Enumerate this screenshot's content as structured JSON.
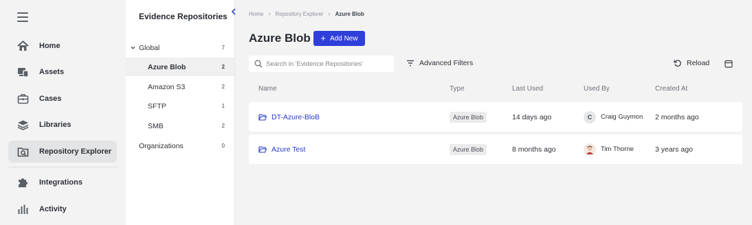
{
  "nav": {
    "items": [
      {
        "label": "Home",
        "icon": "home-icon"
      },
      {
        "label": "Assets",
        "icon": "assets-icon"
      },
      {
        "label": "Cases",
        "icon": "briefcase-icon"
      },
      {
        "label": "Libraries",
        "icon": "layers-icon"
      },
      {
        "label": "Repository Explorer",
        "icon": "folder-search-icon"
      },
      {
        "label": "Integrations",
        "icon": "puzzle-icon"
      },
      {
        "label": "Activity",
        "icon": "bar-chart-icon"
      }
    ],
    "active": "Repository Explorer"
  },
  "tree": {
    "title": "Evidence Repositories",
    "global": {
      "label": "Global",
      "count": "7"
    },
    "children": [
      {
        "label": "Azure Blob",
        "count": "2"
      },
      {
        "label": "Amazon S3",
        "count": "2"
      },
      {
        "label": "SFTP",
        "count": "1"
      },
      {
        "label": "SMB",
        "count": "2"
      }
    ],
    "organizations": {
      "label": "Organizations",
      "count": "0"
    }
  },
  "breadcrumb": {
    "home": "Home",
    "section": "Repository Explorer",
    "current": "Azure Blob"
  },
  "header": {
    "title": "Azure Blob",
    "add_label": "Add New"
  },
  "toolbar": {
    "search_placeholder": "Search in 'Evidence Repositories'",
    "advanced_filters": "Advanced Filters",
    "reload": "Reload"
  },
  "table": {
    "columns": [
      "Name",
      "Type",
      "Last Used",
      "Used By",
      "Created At"
    ],
    "rows": [
      {
        "name": "DT-Azure-BloB",
        "type": "Azure Blob",
        "last_used": "14 days ago",
        "used_by": "Craig Guymon",
        "avatar_initial": "C",
        "created_at": "2 months ago"
      },
      {
        "name": "Azure Test",
        "type": "Azure Blob",
        "last_used": "8 months ago",
        "used_by": "Tim Thorne",
        "avatar_initial": "",
        "created_at": "3 years ago"
      }
    ]
  },
  "colors": {
    "accent": "#2f3fd9",
    "link": "#2638c4",
    "sidebar_bg": "#f3f3f4",
    "active_item": "#e3e4e6"
  }
}
